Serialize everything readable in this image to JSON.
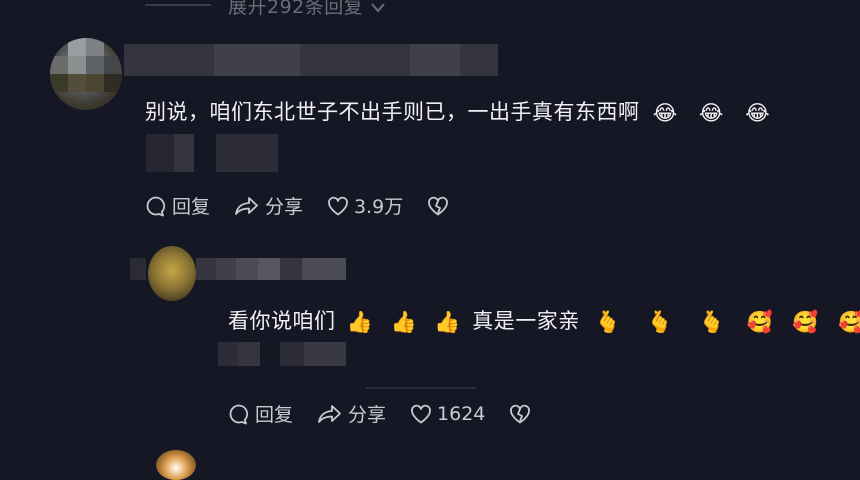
{
  "header": {
    "expand_label": "展开292条回复"
  },
  "comments": [
    {
      "text": "别说，咱们东北世子不出手则已，一出手真有东西啊",
      "emojis": [
        "😂",
        "😂",
        "😂"
      ],
      "actions": {
        "reply": "回复",
        "share": "分享",
        "likes": "3.9万"
      }
    },
    {
      "text": "看你说咱们",
      "emojis_a": [
        "👍",
        "👍",
        "👍"
      ],
      "text_mid": "真是一家亲",
      "emojis_b": [
        "🫰",
        "🫰",
        "🫰",
        "🥰",
        "🥰",
        "🥰"
      ],
      "actions": {
        "reply": "回复",
        "share": "分享",
        "likes": "1624"
      }
    }
  ],
  "icons": {
    "reply": "speech-bubble-icon",
    "share": "share-arrow-icon",
    "like": "heart-icon",
    "dislike": "broken-heart-icon",
    "expand": "chevron-down-icon"
  }
}
